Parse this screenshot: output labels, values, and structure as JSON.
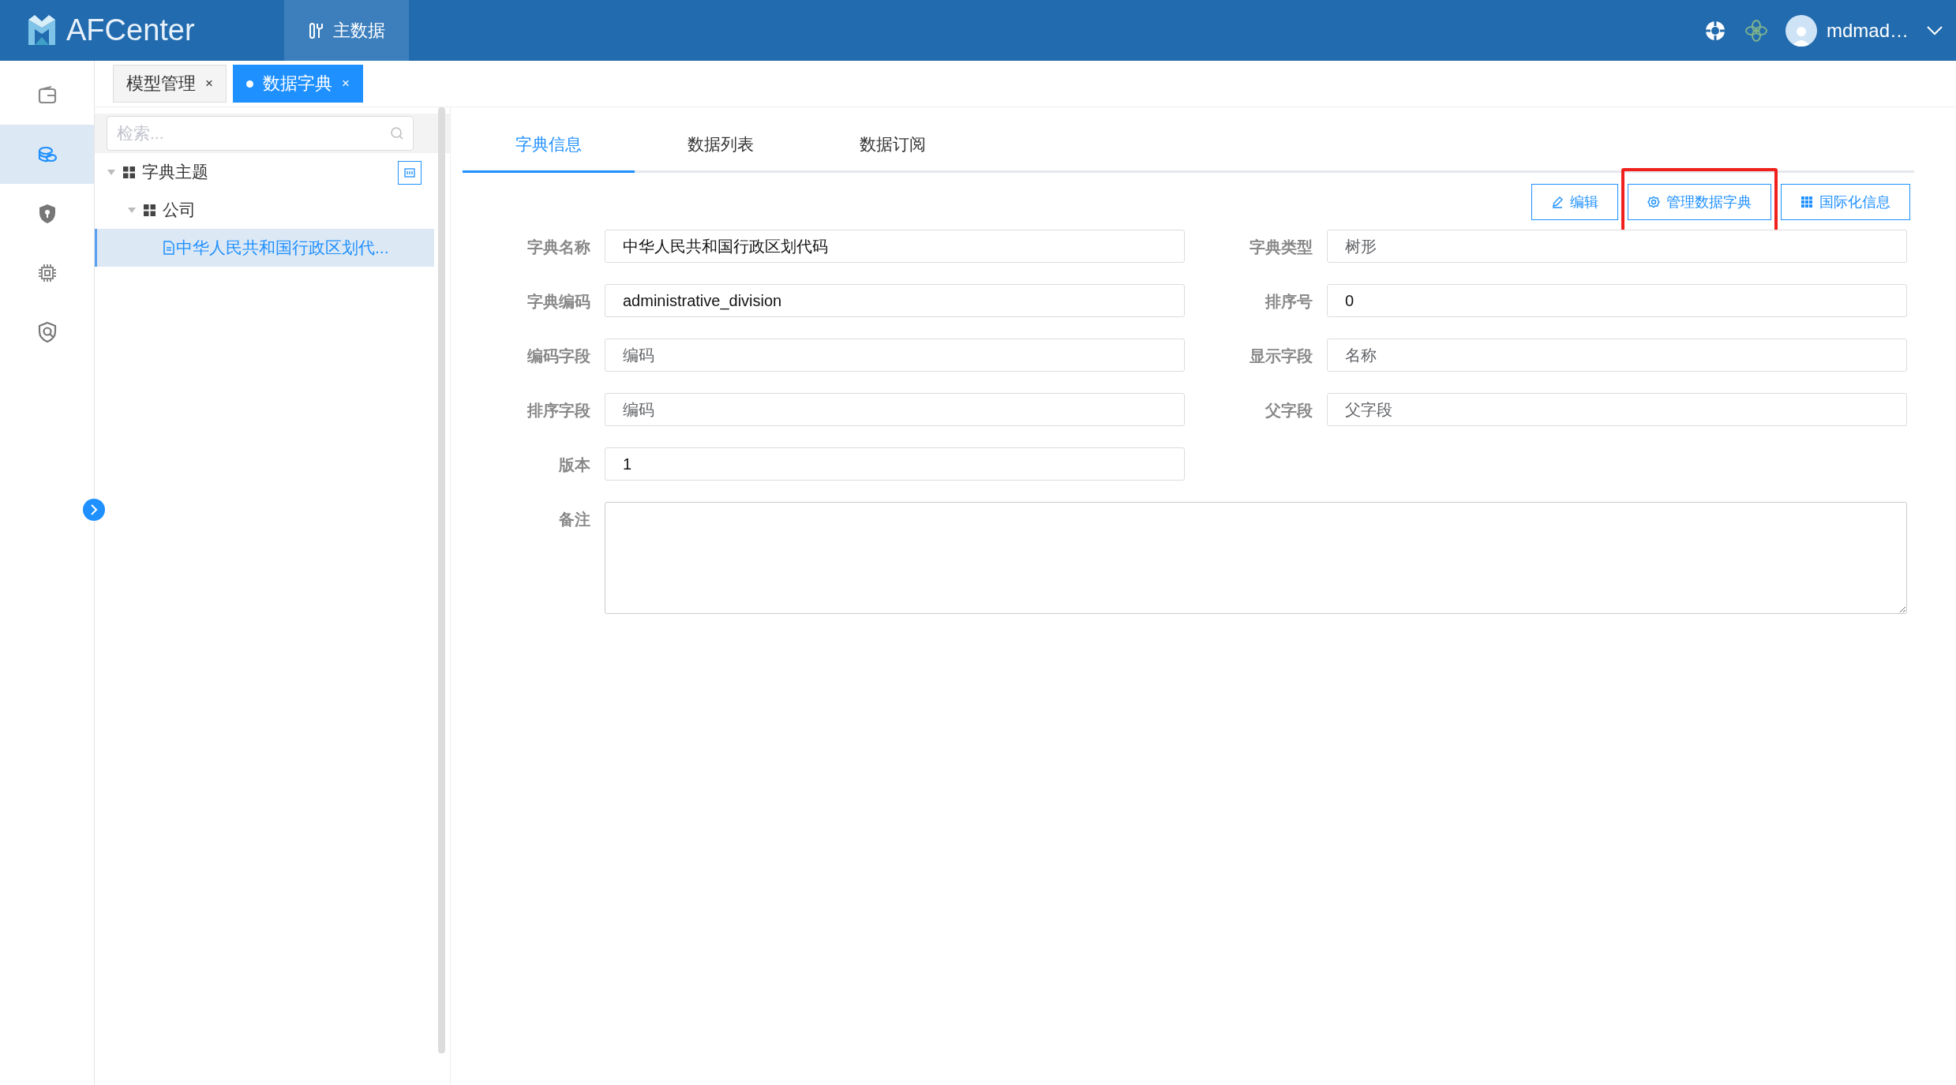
{
  "header": {
    "app_name": "AFCenter",
    "nav": [
      {
        "label": "主数据",
        "selected": true
      }
    ],
    "user": {
      "name": "mdmad…"
    }
  },
  "sidebar": {
    "items": [
      {
        "kind": "wallet",
        "selected": false
      },
      {
        "kind": "coins",
        "selected": true
      },
      {
        "kind": "shield",
        "selected": false
      },
      {
        "kind": "chip",
        "selected": false
      },
      {
        "kind": "shield-search",
        "selected": false
      }
    ]
  },
  "page_tabs": [
    {
      "label": "模型管理",
      "close": "×",
      "selected": false
    },
    {
      "label": "数据字典",
      "close": "×",
      "selected": true
    }
  ],
  "tree": {
    "search": {
      "placeholder": "检索..."
    },
    "items": [
      {
        "label": "字典主题",
        "kind": "folder",
        "expanded": true,
        "selected": false,
        "children": [
          {
            "label": "公司",
            "kind": "folder",
            "expanded": true,
            "selected": false,
            "children": [
              {
                "label": "中华人民共和国行政区划代...",
                "kind": "file",
                "selected": true
              }
            ]
          }
        ]
      }
    ]
  },
  "content_tabs": [
    {
      "label": "字典信息",
      "selected": true
    },
    {
      "label": "数据列表",
      "selected": false
    },
    {
      "label": "数据订阅",
      "selected": false
    }
  ],
  "toolbar": {
    "buttons": [
      {
        "label": "编辑",
        "kind": "edit",
        "highlighted": false
      },
      {
        "label": "管理数据字典",
        "kind": "manage",
        "highlighted": true
      },
      {
        "label": "国际化信息",
        "kind": "i18n",
        "highlighted": false
      }
    ]
  },
  "form": {
    "fields": [
      {
        "label": "字典名称",
        "value": "中华人民共和国行政区划代码",
        "disabled": false
      },
      {
        "label": "字典类型",
        "value": "树形",
        "disabled": true
      },
      {
        "label": "字典编码",
        "value": "administrative_division",
        "disabled": false
      },
      {
        "label": "排序号",
        "value": "0",
        "disabled": false
      },
      {
        "label": "编码字段",
        "value": "编码",
        "disabled": true
      },
      {
        "label": "显示字段",
        "value": "名称",
        "disabled": true
      },
      {
        "label": "排序字段",
        "value": "编码",
        "disabled": true
      },
      {
        "label": "父字段",
        "value": "父字段",
        "disabled": true
      },
      {
        "label": "版本",
        "value": "1",
        "disabled": false
      }
    ],
    "remark": {
      "label": "备注"
    }
  }
}
